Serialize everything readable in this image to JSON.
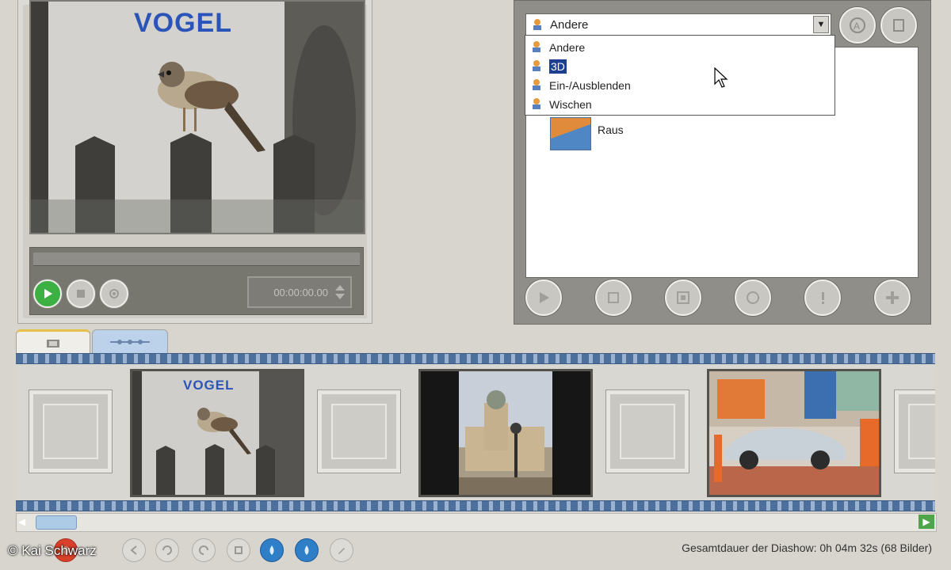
{
  "preview": {
    "logo_text": "VOGEL",
    "time": "00:00:00.00"
  },
  "transitions": {
    "category_selected": "Andere",
    "dropdown_items": [
      "Andere",
      "3D",
      "Ein-/Ausblenden",
      "Wischen"
    ],
    "highlighted_item": "3D",
    "list_items": [
      "Raus"
    ]
  },
  "filmstrip": {
    "photo1_logo": "VOGEL"
  },
  "status": {
    "total_duration": "Gesamtdauer der Diashow: 0h 04m 32s (68 Bilder)"
  },
  "watermark": "© Kai Schwarz",
  "colors": {
    "play_green": "#3cb043",
    "accent_blue": "#2f7fc8",
    "record_red": "#d9402b"
  }
}
